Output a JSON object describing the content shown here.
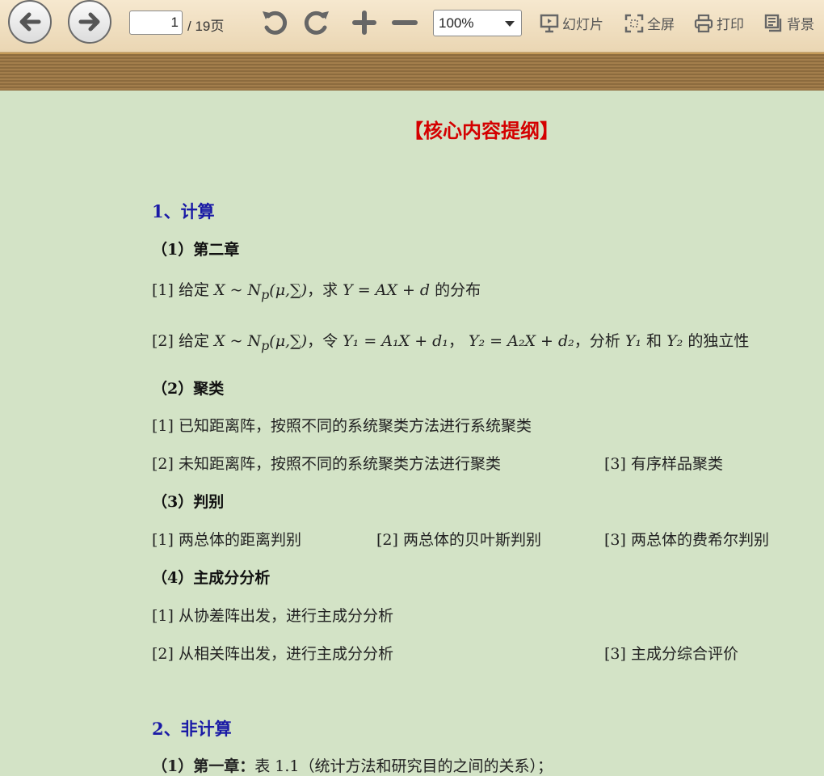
{
  "toolbar": {
    "page_current": "1",
    "page_total": "/ 19页",
    "zoom": "100%",
    "slideshow": "幻灯片",
    "fullscreen": "全屏",
    "print": "打印",
    "background": "背景"
  },
  "doc": {
    "title": "【核心内容提纲】",
    "s1": "1、计算",
    "s1_1": "（1）第二章",
    "s1_1_a_pre": "[1]  给定 ",
    "s1_1_a_math": "X ~ N",
    "s1_1_a_sub": "p",
    "s1_1_a_math2": "(μ,∑)",
    "s1_1_a_mid": "，求 ",
    "s1_1_a_math3": "Y = AX + d",
    "s1_1_a_post": " 的分布",
    "s1_1_b_pre": "[2]  给定 ",
    "s1_1_b_math": "X ~ N",
    "s1_1_b_sub": "p",
    "s1_1_b_math2": "(μ,∑)",
    "s1_1_b_mid": "，令 ",
    "s1_1_b_eq1": "Y₁ = A₁X + d₁",
    "s1_1_b_sep": "，  ",
    "s1_1_b_eq2": "Y₂ = A₂X + d₂",
    "s1_1_b_mid2": "，分析 ",
    "s1_1_b_y1": "Y₁",
    "s1_1_b_and": " 和 ",
    "s1_1_b_y2": "Y₂",
    "s1_1_b_post": " 的独立性",
    "s1_2": "（2）聚类",
    "s1_2_a": "[1]  已知距离阵，按照不同的系统聚类方法进行系统聚类",
    "s1_2_b": "[2]  未知距离阵，按照不同的系统聚类方法进行聚类",
    "s1_2_c": "[3]  有序样品聚类",
    "s1_3": "（3）判别",
    "s1_3_a": "[1]  两总体的距离判别",
    "s1_3_b": "[2]  两总体的贝叶斯判别",
    "s1_3_c": "[3]  两总体的费希尔判别",
    "s1_4": "（4）主成分分析",
    "s1_4_a": "[1]  从协差阵出发，进行主成分分析",
    "s1_4_b": "[2]  从相关阵出发，进行主成分分析",
    "s1_4_c": "[3]  主成分综合评价",
    "s2": "2、非计算",
    "s2_1_bold": "（1）第一章：",
    "s2_1_rest": "表 1.1（统计方法和研究目的之间的关系）；"
  }
}
